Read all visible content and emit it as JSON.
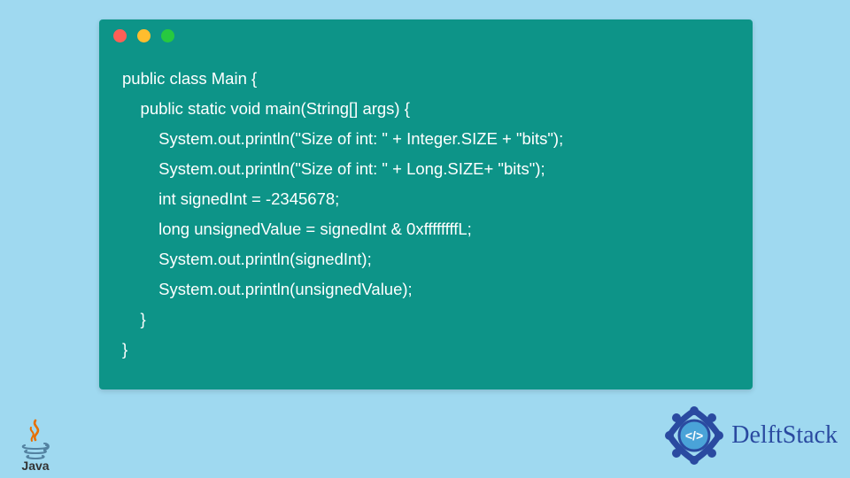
{
  "window": {
    "dots": [
      "red",
      "yellow",
      "green"
    ]
  },
  "code": {
    "line1": "public class Main {",
    "line2": "    public static void main(String[] args) {",
    "line3": "        System.out.println(\"Size of int: \" + Integer.SIZE + \"bits\");",
    "line4": "        System.out.println(\"Size of int: \" + Long.SIZE+ \"bits\");",
    "line5": "        int signedInt = -2345678;",
    "line6": "        long unsignedValue = signedInt & 0xffffffffL;",
    "line7": "        System.out.println(signedInt);",
    "line8": "        System.out.println(unsignedValue);",
    "line9": "    }",
    "line10": "}"
  },
  "logos": {
    "java_label": "Java",
    "delft_label": "DelftStack"
  },
  "colors": {
    "page_bg": "#9fd9f0",
    "window_bg": "#0d9488",
    "code_fg": "#ffffff",
    "delft_brand": "#2a4aa0",
    "dot_red": "#ff5f56",
    "dot_yellow": "#ffbd2e",
    "dot_green": "#27c93f"
  }
}
